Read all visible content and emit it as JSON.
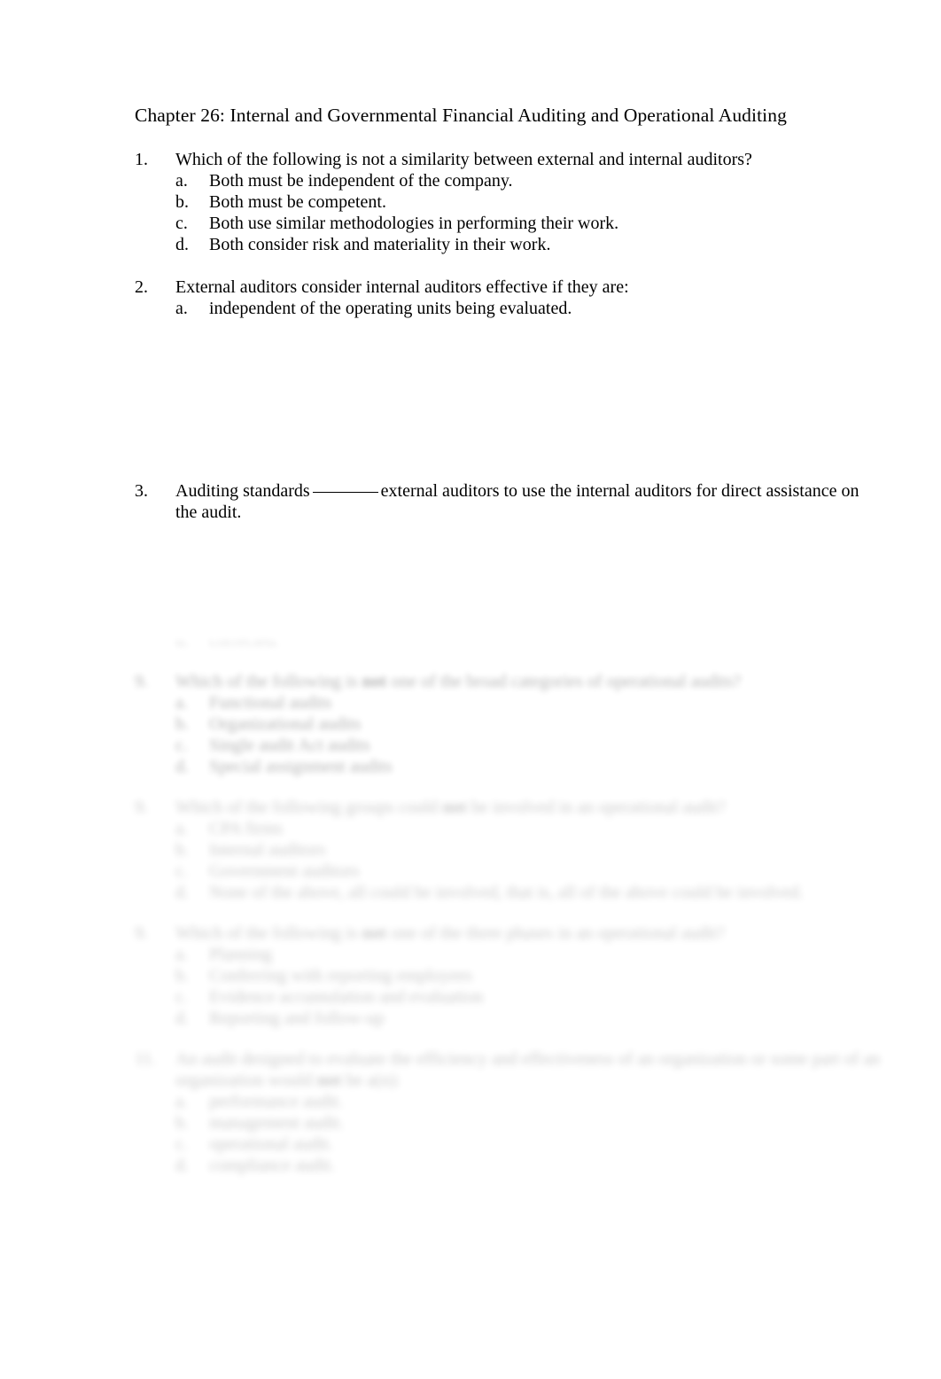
{
  "document": {
    "title": "Chapter 26: Internal and Governmental Financial Auditing and Operational Auditing"
  },
  "questions": [
    {
      "number": "1.",
      "stem_before_emphasis": "Which of the following is ",
      "emphasis": "not",
      "stem_after_emphasis": " a similarity between external and internal auditors?",
      "options": [
        {
          "letter": "a.",
          "text": "Both must be independent of the company."
        },
        {
          "letter": "b.",
          "text": "Both must be competent."
        },
        {
          "letter": "c.",
          "text": "Both use similar methodologies in performing their work."
        },
        {
          "letter": "d.",
          "text": "Both consider risk and materiality in their work."
        }
      ]
    },
    {
      "number": "2.",
      "stem": "External auditors consider internal auditors effective if they are:",
      "options": [
        {
          "letter": "a.",
          "text": "independent of the operating units being evaluated."
        }
      ]
    },
    {
      "number": "3.",
      "stem_before_blank": "Auditing standards",
      "stem_after_blank": "external auditors to use the internal auditors for direct assistance on the audit."
    }
  ],
  "faded_questions": [
    {
      "number": "9.",
      "stem_before_emphasis": "Which of the following is ",
      "emphasis": "not",
      "stem_after_emphasis": " one of the broad categories of operational audits?",
      "options": [
        {
          "letter": "a.",
          "text": "Functional audits"
        },
        {
          "letter": "b.",
          "text": "Organizational audits"
        },
        {
          "letter": "c.",
          "text": "Single audit Act audits"
        },
        {
          "letter": "d.",
          "text": "Special assignment audits"
        }
      ]
    },
    {
      "number": "9.",
      "stem_before_emphasis": "Which of the following groups could ",
      "emphasis": "not",
      "stem_after_emphasis": " be involved in an operational audit?",
      "options": [
        {
          "letter": "a.",
          "text": "CPA firms"
        },
        {
          "letter": "b.",
          "text": "Internal auditors"
        },
        {
          "letter": "c.",
          "text": "Government auditors"
        },
        {
          "letter": "d.",
          "text": "None of the above, all could be involved, that is, all of the above could be involved."
        }
      ]
    },
    {
      "number": "9.",
      "stem_before_emphasis": "Which of the following is ",
      "emphasis": "not",
      "stem_after_emphasis": " one of the three phases in an operational audit?",
      "options": [
        {
          "letter": "a.",
          "text": "Planning"
        },
        {
          "letter": "b.",
          "text": "Conferring with reporting employees"
        },
        {
          "letter": "c.",
          "text": "Evidence accumulation and evaluation"
        },
        {
          "letter": "d.",
          "text": "Reporting and follow-up"
        }
      ]
    },
    {
      "number": "11.",
      "stem_before_emphasis": "An audit designed to evaluate the efficiency and effectiveness of an organization or some part of an organization would ",
      "emphasis": "not",
      "stem_after_emphasis": " be a(n):",
      "options": [
        {
          "letter": "a.",
          "text": "performance audit."
        },
        {
          "letter": "b.",
          "text": "management audit."
        },
        {
          "letter": "c.",
          "text": "operational audit."
        },
        {
          "letter": "d.",
          "text": "compliance audit."
        }
      ]
    }
  ],
  "cut_off_line": {
    "letter": "d.",
    "text": "corrected."
  }
}
